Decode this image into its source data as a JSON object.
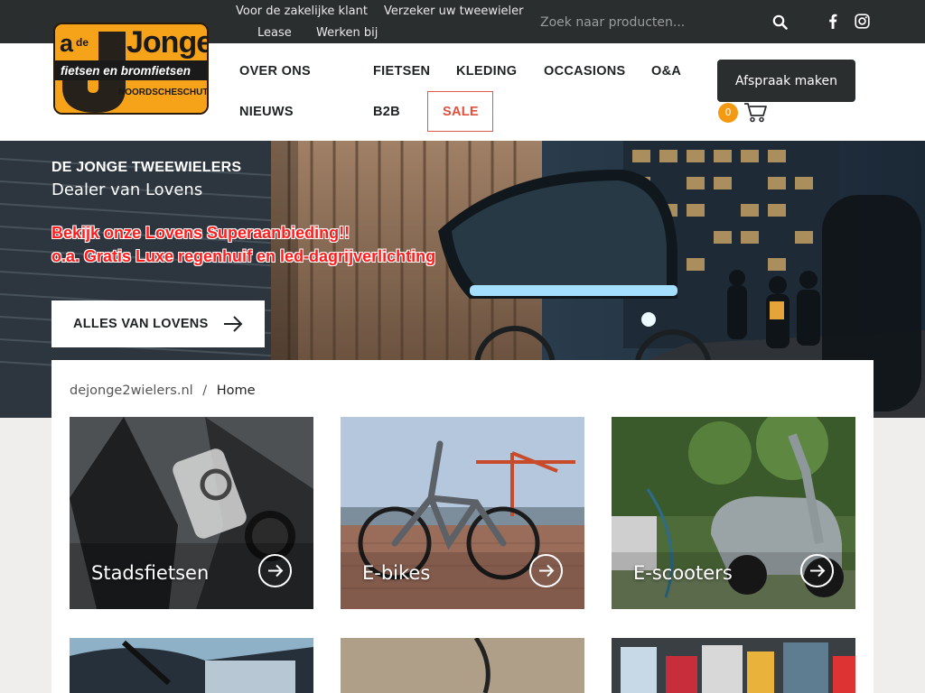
{
  "topbar": {
    "links": [
      "Voor de zakelijke klant",
      "Verzeker uw tweewieler",
      "Lease",
      "Werken bij"
    ],
    "search_placeholder": "Zoek naar producten...",
    "icons": [
      "search-icon",
      "facebook-icon",
      "instagram-icon"
    ]
  },
  "logo": {
    "a": "a",
    "de": "de",
    "jonge": "Jonge",
    "tagline": "fietsen en bromfietsen",
    "place": "NOORDSCHESCHUT"
  },
  "nav": {
    "items": [
      "OVER ONS",
      "FIETSEN",
      "KLEDING",
      "OCCASIONS",
      "O&A",
      "NIEUWS",
      "B2B",
      "SALE"
    ]
  },
  "header": {
    "appointment_label": "Afspraak maken",
    "cart_count": "0"
  },
  "hero": {
    "title": "DE JONGE TWEEWIELERS",
    "subtitle": "Dealer van Lovens",
    "promo_line1": "Bekijk onze Lovens Superaanbieding!!",
    "promo_line2": "o.a. Gratis Luxe regenhuif en led-dagrijverlichting",
    "button_label": "ALLES VAN LOVENS"
  },
  "breadcrumb": {
    "site": "dejonge2wielers.nl",
    "separator": "/",
    "current": "Home"
  },
  "categories": [
    {
      "label": "Stadsfietsen"
    },
    {
      "label": "E-bikes"
    },
    {
      "label": "E-scooters"
    }
  ],
  "colors": {
    "topbar": "#2b2e2f",
    "accent_orange": "#f39a12",
    "sale_red": "#e05a4a",
    "promo_red": "#ff1c1c"
  }
}
